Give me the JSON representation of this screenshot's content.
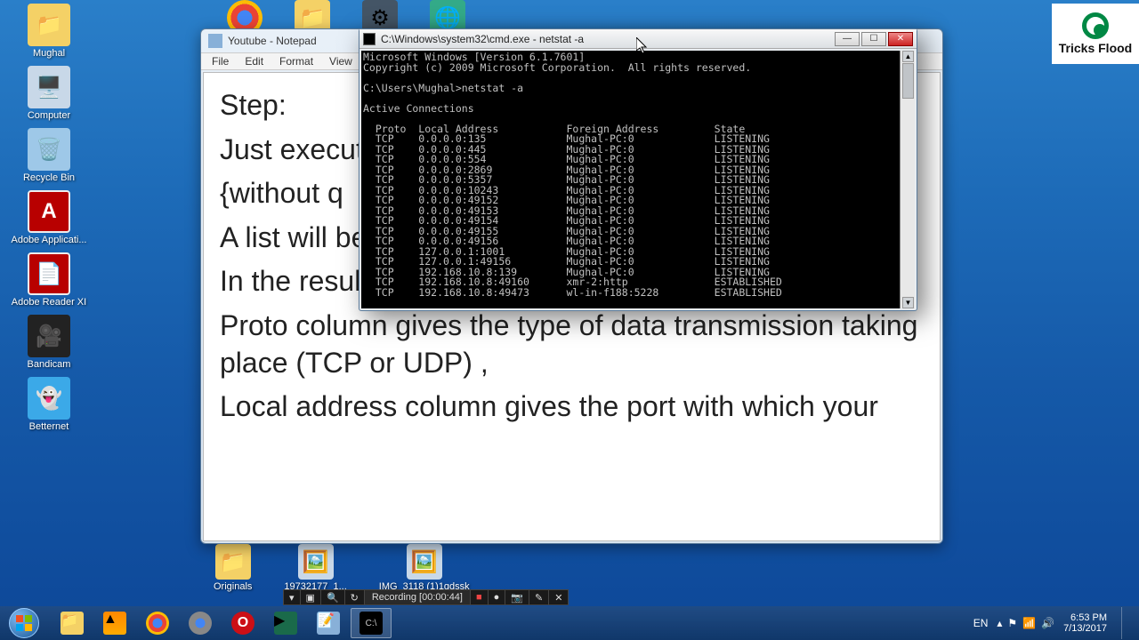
{
  "desktop": {
    "icons": [
      {
        "label": "Mughal"
      },
      {
        "label": "Computer"
      },
      {
        "label": "Recycle Bin"
      },
      {
        "label": "Adobe Applicati..."
      },
      {
        "label": "Adobe Reader XI"
      },
      {
        "label": "Bandicam"
      },
      {
        "label": "Betternet"
      }
    ],
    "row_bottom": [
      {
        "label": "Originals"
      },
      {
        "label": "19732177_1..."
      },
      {
        "label": "IMG_3118 (1)1qdssk"
      }
    ]
  },
  "notepad": {
    "title": "Youtube - Notepad",
    "menu": [
      "File",
      "Edit",
      "Format",
      "View"
    ],
    "body_lines": [
      "Step:",
      "",
      "Just execut",
      "{without q",
      "",
      "A list will be shown to you:",
      "",
      "In the results returned,",
      "Proto column gives the type of data transmission taking place (TCP or UDP) ,",
      "Local address column gives the port with which your"
    ]
  },
  "cmd": {
    "title": "C:\\Windows\\system32\\cmd.exe - netstat  -a",
    "header1": "Microsoft Windows [Version 6.1.7601]",
    "header2": "Copyright (c) 2009 Microsoft Corporation.  All rights reserved.",
    "prompt": "C:\\Users\\Mughal>netstat -a",
    "active": "Active Connections",
    "col_proto": "Proto",
    "col_local": "Local Address",
    "col_foreign": "Foreign Address",
    "col_state": "State",
    "rows": [
      {
        "proto": "TCP",
        "local": "0.0.0.0:135",
        "foreign": "Mughal-PC:0",
        "state": "LISTENING"
      },
      {
        "proto": "TCP",
        "local": "0.0.0.0:445",
        "foreign": "Mughal-PC:0",
        "state": "LISTENING"
      },
      {
        "proto": "TCP",
        "local": "0.0.0.0:554",
        "foreign": "Mughal-PC:0",
        "state": "LISTENING"
      },
      {
        "proto": "TCP",
        "local": "0.0.0.0:2869",
        "foreign": "Mughal-PC:0",
        "state": "LISTENING"
      },
      {
        "proto": "TCP",
        "local": "0.0.0.0:5357",
        "foreign": "Mughal-PC:0",
        "state": "LISTENING"
      },
      {
        "proto": "TCP",
        "local": "0.0.0.0:10243",
        "foreign": "Mughal-PC:0",
        "state": "LISTENING"
      },
      {
        "proto": "TCP",
        "local": "0.0.0.0:49152",
        "foreign": "Mughal-PC:0",
        "state": "LISTENING"
      },
      {
        "proto": "TCP",
        "local": "0.0.0.0:49153",
        "foreign": "Mughal-PC:0",
        "state": "LISTENING"
      },
      {
        "proto": "TCP",
        "local": "0.0.0.0:49154",
        "foreign": "Mughal-PC:0",
        "state": "LISTENING"
      },
      {
        "proto": "TCP",
        "local": "0.0.0.0:49155",
        "foreign": "Mughal-PC:0",
        "state": "LISTENING"
      },
      {
        "proto": "TCP",
        "local": "0.0.0.0:49156",
        "foreign": "Mughal-PC:0",
        "state": "LISTENING"
      },
      {
        "proto": "TCP",
        "local": "127.0.0.1:1001",
        "foreign": "Mughal-PC:0",
        "state": "LISTENING"
      },
      {
        "proto": "TCP",
        "local": "127.0.0.1:49156",
        "foreign": "Mughal-PC:0",
        "state": "LISTENING"
      },
      {
        "proto": "TCP",
        "local": "192.168.10.8:139",
        "foreign": "Mughal-PC:0",
        "state": "LISTENING"
      },
      {
        "proto": "TCP",
        "local": "192.168.10.8:49160",
        "foreign": "xmr-2:http",
        "state": "ESTABLISHED"
      },
      {
        "proto": "TCP",
        "local": "192.168.10.8:49473",
        "foreign": "wl-in-f188:5228",
        "state": "ESTABLISHED"
      }
    ]
  },
  "logo": {
    "text": "Tricks Flood"
  },
  "rec_bar": {
    "status": "Recording [00:00:44]"
  },
  "systray": {
    "lang": "EN",
    "time": "6:53 PM",
    "date": "7/13/2017"
  }
}
